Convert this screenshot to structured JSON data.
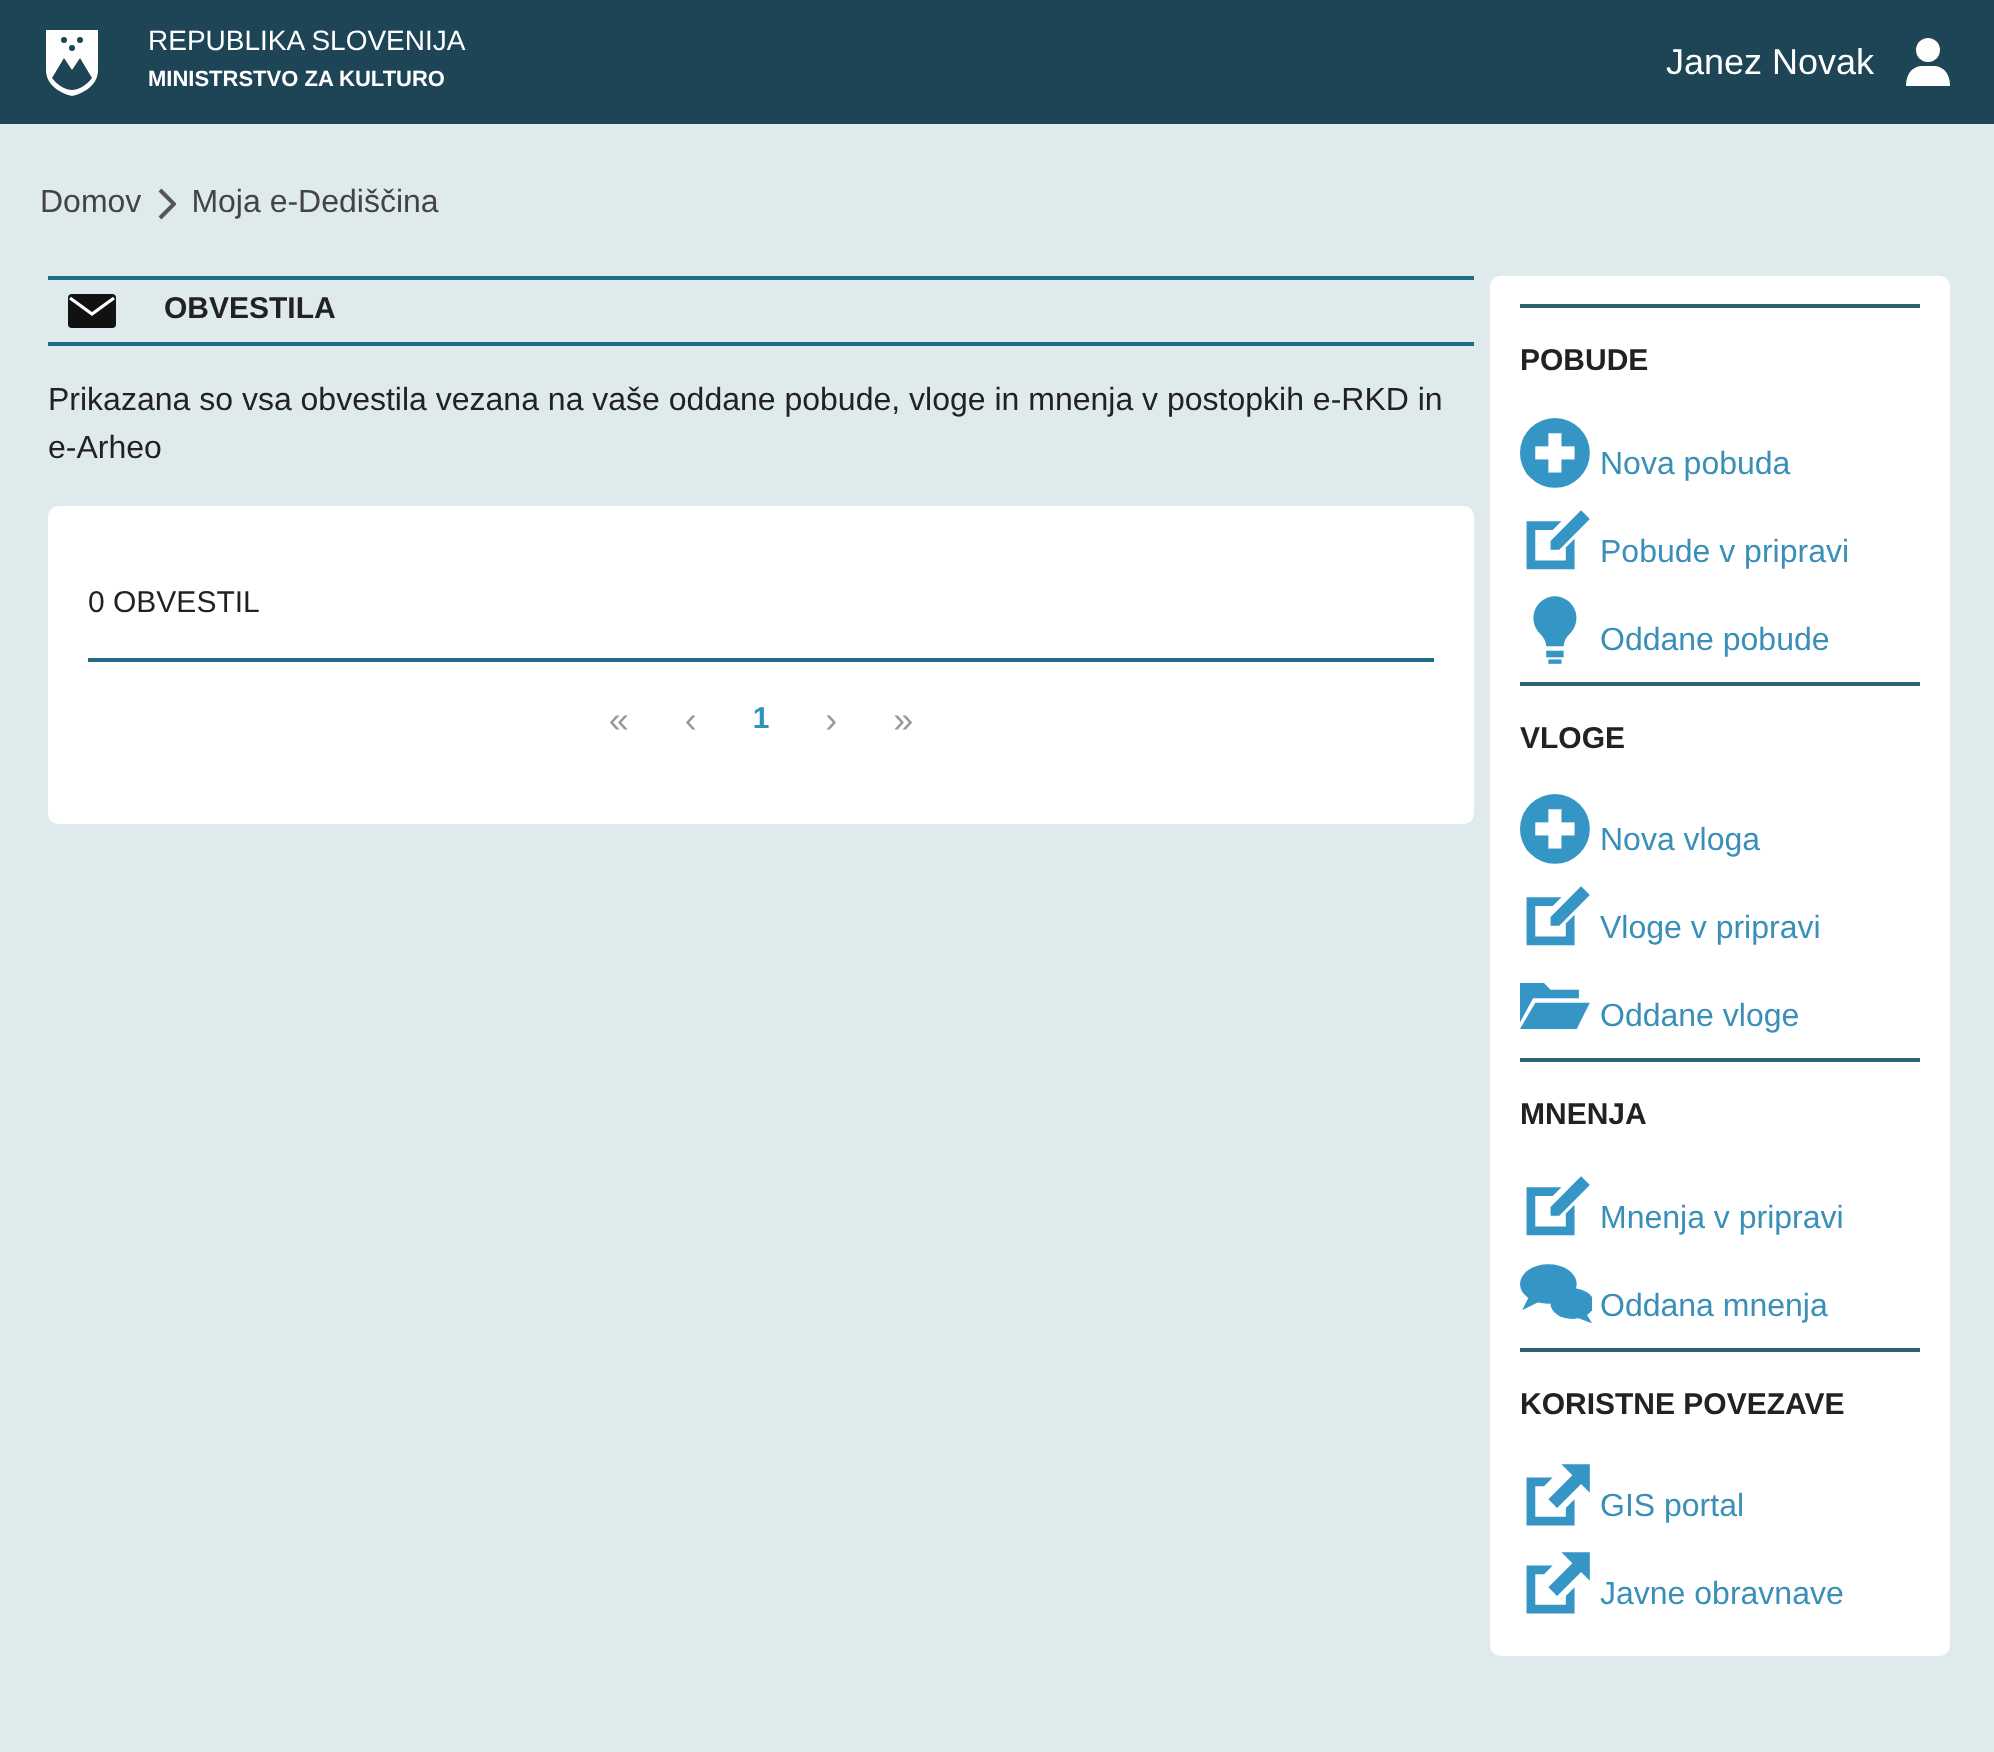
{
  "header": {
    "title": "REPUBLIKA SLOVENIJA",
    "subtitle": "MINISTRSTVO ZA KULTURO",
    "user": "Janez Novak"
  },
  "breadcrumb": [
    {
      "label": "Domov"
    },
    {
      "label": "Moja e-Dediščina"
    }
  ],
  "notices": {
    "title": "OBVESTILA",
    "description": "Prikazana so vsa obvestila vezana na vaše oddane pobude, vloge in mnenja v postopkih e-RKD in e-Arheo",
    "count": "0 OBVESTIL",
    "pagination": [
      {
        "label": "«",
        "selected": false
      },
      {
        "label": "‹",
        "selected": false
      },
      {
        "label": "1",
        "selected": true
      },
      {
        "label": "›",
        "selected": false
      },
      {
        "label": "»",
        "selected": false
      }
    ]
  },
  "sidebar": [
    {
      "title": "POBUDE",
      "items": [
        {
          "label": "Nova pobuda"
        },
        {
          "label": "Pobude v pripravi"
        },
        {
          "label": "Oddane pobude"
        }
      ]
    },
    {
      "title": "VLOGE",
      "items": [
        {
          "label": "Nova vloga"
        },
        {
          "label": "Vloge v pripravi"
        },
        {
          "label": "Oddane vloge"
        }
      ]
    },
    {
      "title": "MNENJA",
      "items": [
        {
          "label": "Mnenja v pripravi"
        },
        {
          "label": "Oddana mnenja"
        }
      ]
    },
    {
      "title": "KORISTNE POVEZAVE",
      "items": [
        {
          "label": "GIS portal"
        },
        {
          "label": "Javne obravnave"
        }
      ]
    }
  ]
}
